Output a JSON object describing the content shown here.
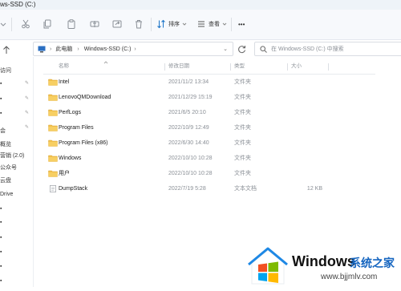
{
  "window": {
    "title": "ws-SSD (C:)"
  },
  "toolbar": {
    "sort_label": "排序",
    "view_label": "查看",
    "more_label": "•••"
  },
  "address": {
    "crumbs": [
      "此电脑",
      "Windows-SSD (C:)"
    ],
    "search_placeholder": "在 Windows-SSD (C:) 中搜索"
  },
  "sidebar": {
    "items": [
      "访问",
      "",
      "",
      "",
      "会",
      "概览",
      "营销 (2.0)",
      "公众号",
      "云盘",
      "Drive",
      "",
      "",
      "",
      "",
      "",
      "",
      "",
      ""
    ]
  },
  "columns": {
    "name": "名称",
    "date": "修改日期",
    "type": "类型",
    "size": "大小"
  },
  "files": [
    {
      "name": "Intel",
      "date": "2021/11/2 13:34",
      "type": "文件夹",
      "size": "",
      "icon": "folder-icon"
    },
    {
      "name": "LenovoQMDownload",
      "date": "2021/12/29 15:19",
      "type": "文件夹",
      "size": "",
      "icon": "folder-icon"
    },
    {
      "name": "PerfLogs",
      "date": "2021/6/5 20:10",
      "type": "文件夹",
      "size": "",
      "icon": "folder-icon"
    },
    {
      "name": "Program Files",
      "date": "2022/10/9 12:49",
      "type": "文件夹",
      "size": "",
      "icon": "folder-icon"
    },
    {
      "name": "Program Files (x86)",
      "date": "2022/6/30 14:40",
      "type": "文件夹",
      "size": "",
      "icon": "folder-icon"
    },
    {
      "name": "Windows",
      "date": "2022/10/10 10:28",
      "type": "文件夹",
      "size": "",
      "icon": "folder-icon"
    },
    {
      "name": "用户",
      "date": "2022/10/10 10:28",
      "type": "文件夹",
      "size": "",
      "icon": "folder-icon"
    },
    {
      "name": "DumpStack",
      "date": "2022/7/19 5:28",
      "type": "文本文档",
      "size": "12 KB",
      "icon": "text-file-icon"
    }
  ],
  "watermark": {
    "brand": "Windows",
    "brand_cn": "系统之家",
    "url": "www.bjjmlv.com"
  },
  "colors": {
    "folder": "#f2c14e",
    "accent": "#0067c0"
  }
}
